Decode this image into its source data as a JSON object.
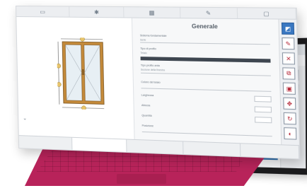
{
  "toolbar": {
    "icons": [
      "save-icon",
      "settings-icon",
      "grid-icon",
      "pencil-icon",
      "expand-icon"
    ],
    "glyphs": [
      "▭",
      "✱",
      "▦",
      "✎",
      "▢"
    ]
  },
  "panel": {
    "title": "Generale",
    "fields": [
      {
        "label": "Sistema fondamentale",
        "value": "Serie"
      },
      {
        "label": "Tipo di profilo",
        "value": "Telaio"
      },
      {
        "label": "Tipo profilo anta",
        "value": "Sezione della finestra"
      },
      {
        "label": "Colore del telaio",
        "value": ""
      },
      {
        "label": "Larghezza",
        "value": ""
      },
      {
        "label": "Altezza",
        "value": ""
      },
      {
        "label": "Quantità",
        "value": ""
      },
      {
        "label": "Posizione",
        "value": ""
      }
    ]
  },
  "side_tools": {
    "icons": [
      "select-icon",
      "edit-icon",
      "delete-icon",
      "copy-icon",
      "open-icon",
      "move-icon",
      "rotate-icon",
      "color-icon"
    ],
    "glyphs": [
      "◩",
      "✎",
      "✕",
      "⧉",
      "▣",
      "✥",
      "↻",
      "◐"
    ]
  },
  "bottom_tabs": [
    "",
    "",
    "",
    "",
    ""
  ],
  "drawing": {
    "frame_color": "#c48a3a",
    "glass_color": "#e7eff4",
    "dimension_marker_color": "#e8c46a"
  },
  "laptop": {
    "keyboard_color": "#b8235a"
  }
}
